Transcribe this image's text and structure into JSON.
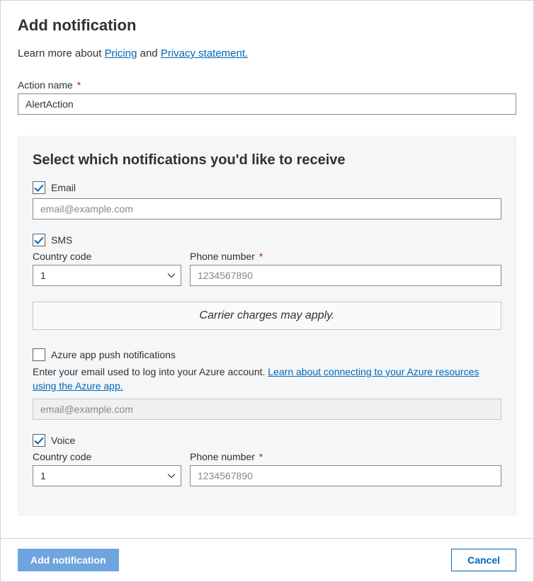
{
  "header": {
    "title": "Add notification",
    "intro_prefix": "Learn more about ",
    "link_pricing": "Pricing",
    "intro_and": "  and  ",
    "link_privacy": " Privacy statement."
  },
  "action_name": {
    "label": "Action name",
    "value": "AlertAction"
  },
  "panel": {
    "heading": "Select which notifications you'd like to receive",
    "email": {
      "label": "Email",
      "checked": true,
      "placeholder": "email@example.com",
      "value": ""
    },
    "sms": {
      "label": "SMS",
      "checked": true,
      "country_code_label": "Country code",
      "country_code_value": "1",
      "phone_label": "Phone number",
      "phone_placeholder": "1234567890",
      "phone_value": "",
      "carrier_notice": "Carrier charges may apply."
    },
    "azure_push": {
      "label": "Azure app push notifications",
      "checked": false,
      "help_prefix": "Enter your email used to log into your Azure account.  ",
      "help_link": "Learn about connecting to your Azure resources using the Azure app.",
      "placeholder": "email@example.com",
      "value": ""
    },
    "voice": {
      "label": "Voice",
      "checked": true,
      "country_code_label": "Country code",
      "country_code_value": "1",
      "phone_label": "Phone number",
      "phone_placeholder": "1234567890",
      "phone_value": ""
    }
  },
  "footer": {
    "primary": "Add notification",
    "secondary": "Cancel"
  }
}
